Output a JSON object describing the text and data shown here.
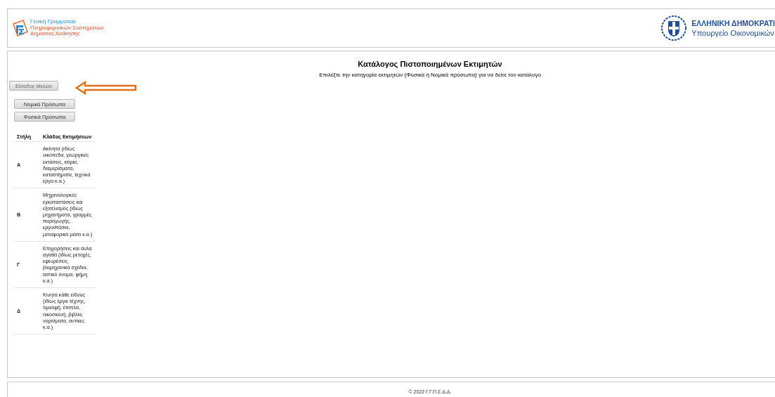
{
  "header": {
    "agency_lines": [
      "Γενική Γραμματεία",
      "Πληροφοριακών Συστημάτων",
      "Δημόσιας Διοίκησης"
    ],
    "republic": "ΕΛΛΗΝΙΚΗ ΔΗΜΟΚΡΑΤΙ",
    "ministry": "Υπουργείο Οικονομικών"
  },
  "title": "Κατάλογος Πιστοποιημένων Εκτιμητών",
  "subtitle": "Επιλέξτε την κατηγορία εκτιμητών (Φυσικά ή Νομικά πρόσωπα) για να δείτε τον κατάλογο",
  "login_button": "Είσοδος Μελών",
  "category_buttons": [
    "Νομικά Πρόσωπα",
    "Φυσικά Πρόσωπα"
  ],
  "table": {
    "columns": [
      "Στήλη",
      "Κλάδος Εκτιμήσεων"
    ],
    "rows": [
      {
        "column": "Α",
        "branch": "Ακίνητα (ιδίως οικόπεδα, γεωργικές εκτάσεις, κτίρια, διαμερίσματα, καταστήματα, τεχνικά έργα κ.α.)"
      },
      {
        "column": "Β",
        "branch": "Μηχανολογικές εγκαταστάσεις και εξοπλισμός (ιδίως μηχανήματα, γραμμές παραγωγής, εργοστάσια, μεταφορικά μέσα κ.α.)"
      },
      {
        "column": "Γ",
        "branch": "Επιχειρήσεις και άυλα αγαθά (ιδίως μετοχές, εφευρέσεις, βιομηχανικά σχέδια, αστικό όνομα, φήμη κ.α.)"
      },
      {
        "column": "Δ",
        "branch": "Κινητά κάθε είδους (ιδίως έργα τέχνης, τιμαλφή, έπιπλα, οικοσκευή, βιβλία, νομίσματα, αντίκες κ.α.)"
      }
    ]
  },
  "footer": "© 2022 Γ.Γ.Π.Σ.Δ.Δ."
}
